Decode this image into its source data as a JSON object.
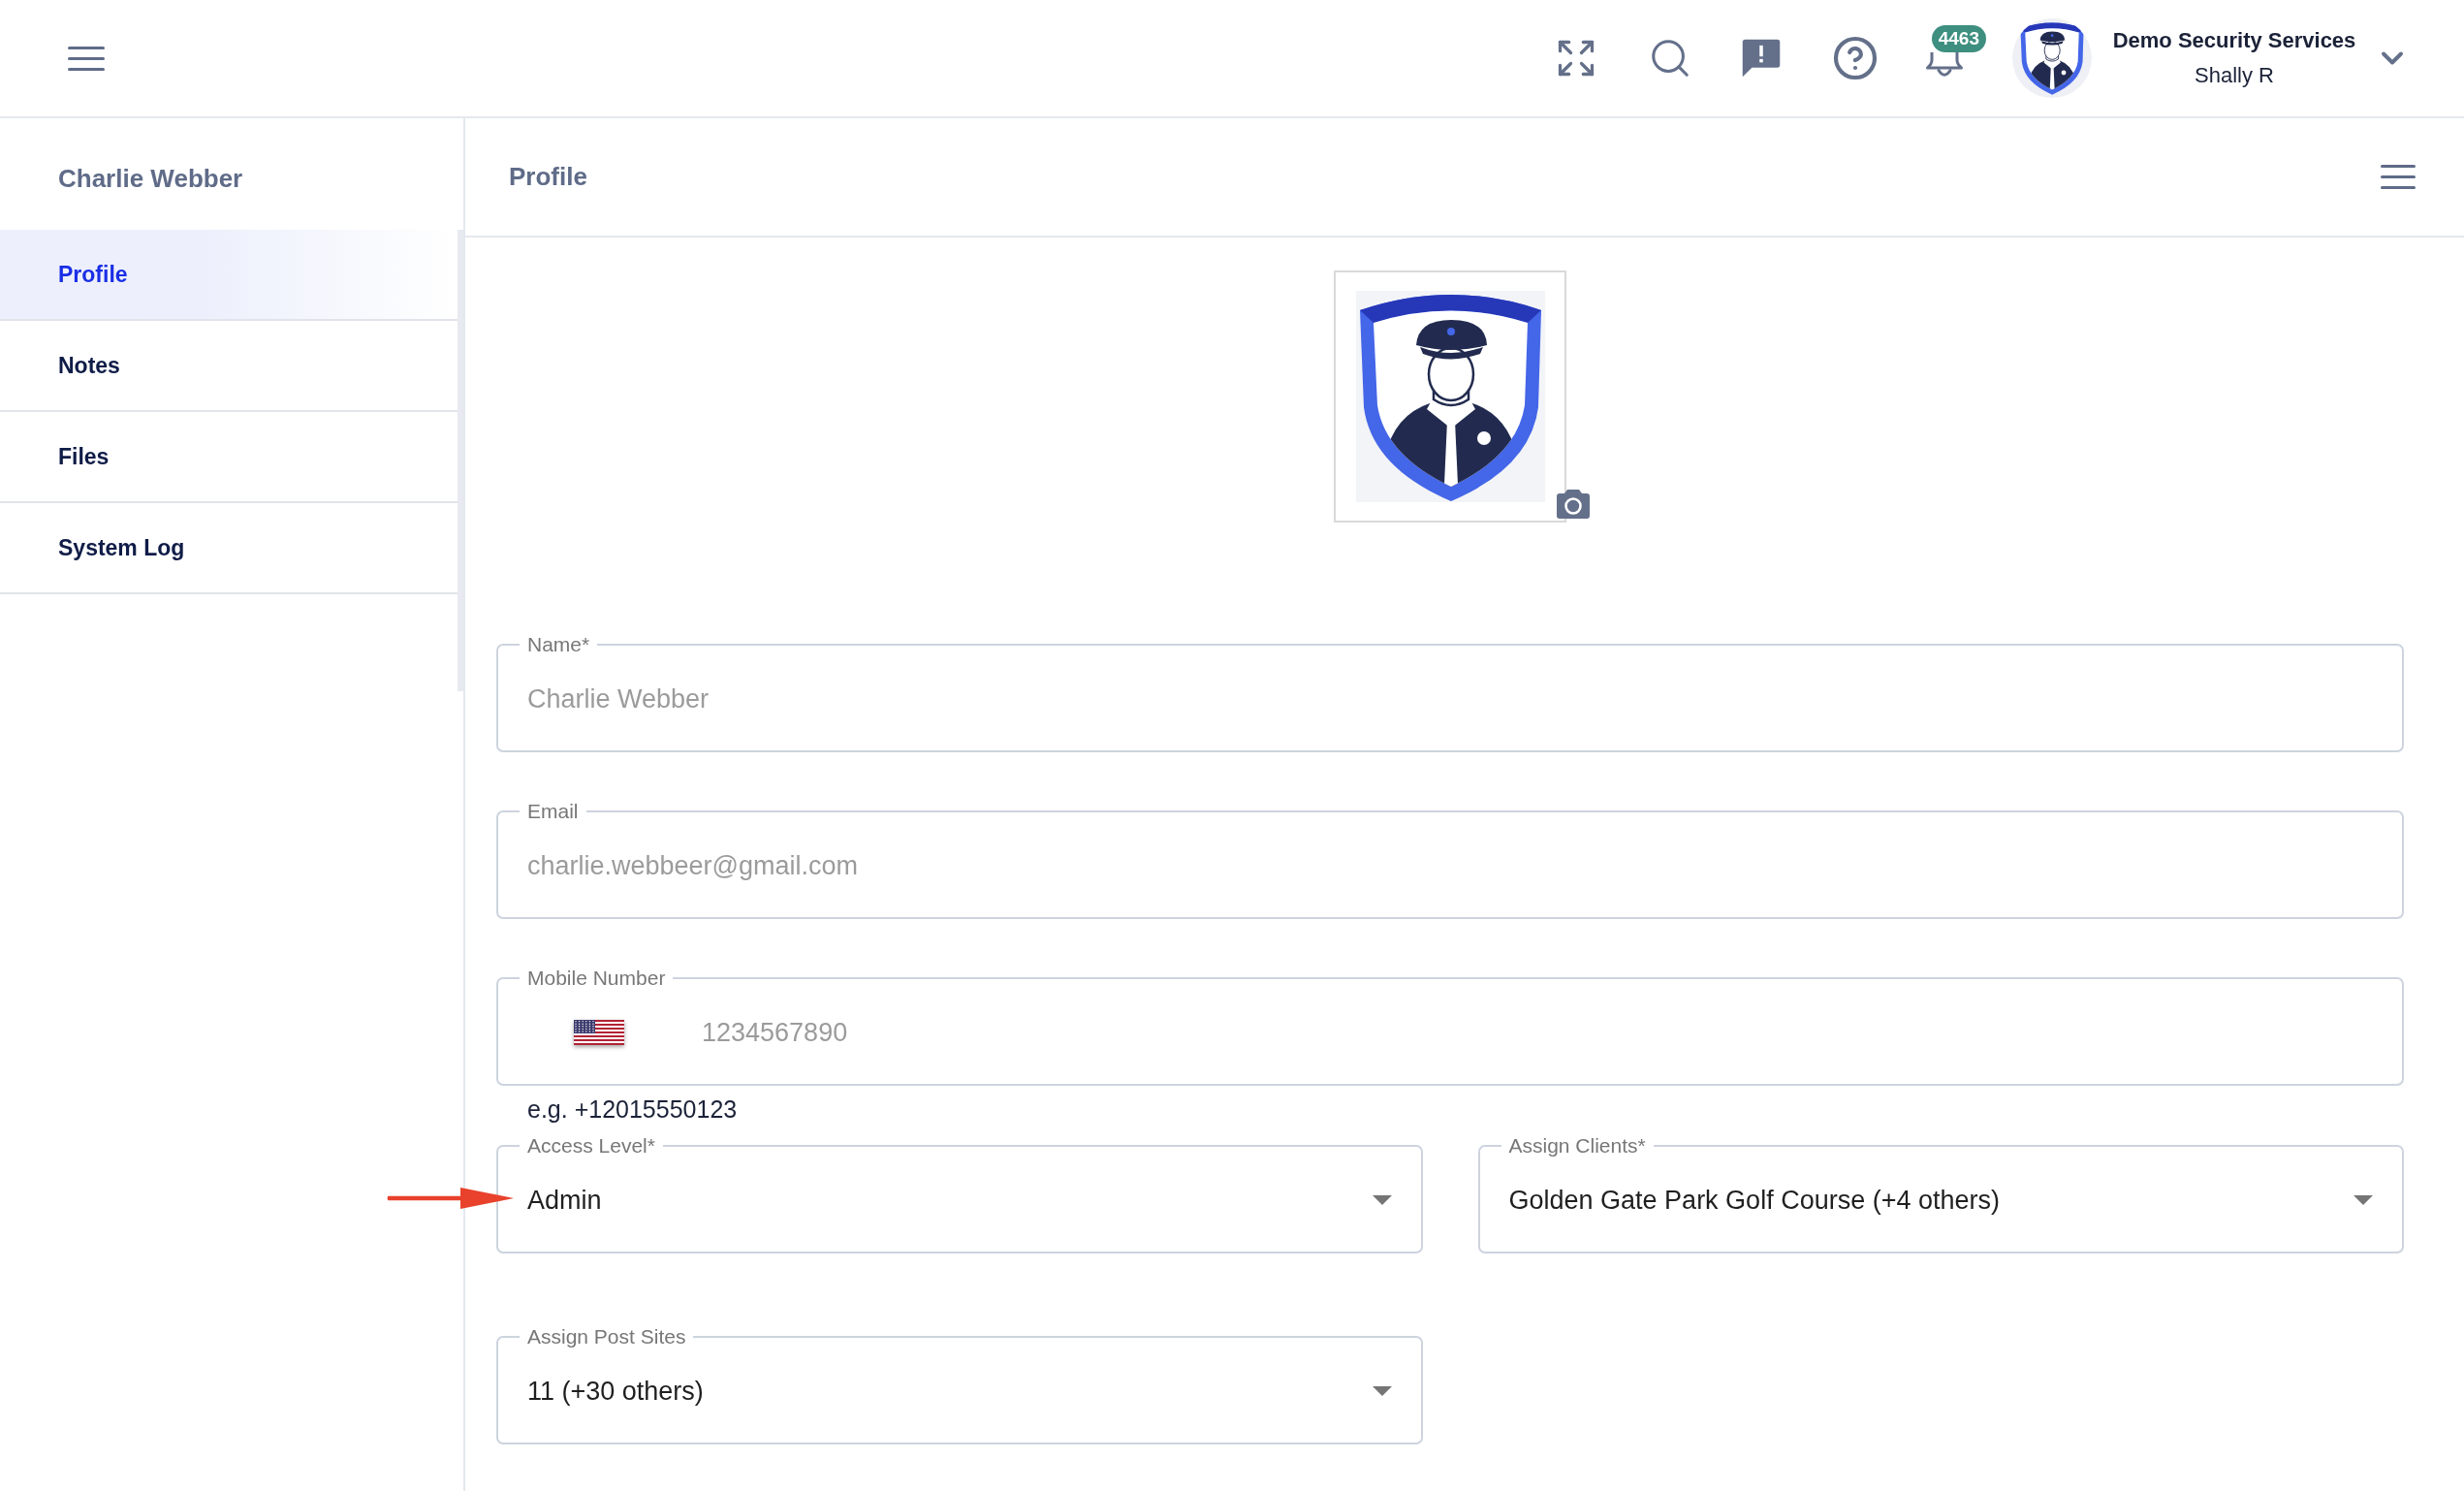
{
  "topbar": {
    "notification_count": "4463",
    "account": {
      "company": "Demo Security Services",
      "user": "Shally R"
    }
  },
  "sidebar": {
    "title": "Charlie Webber",
    "items": [
      {
        "label": "Profile",
        "selected": true
      },
      {
        "label": "Notes",
        "selected": false
      },
      {
        "label": "Files",
        "selected": false
      },
      {
        "label": "System Log",
        "selected": false
      }
    ]
  },
  "main": {
    "title": "Profile"
  },
  "form": {
    "name": {
      "label": "Name*",
      "value": "Charlie Webber",
      "disabled": true
    },
    "email": {
      "label": "Email",
      "value": "charlie.webbeer@gmail.com",
      "disabled": true
    },
    "mobile": {
      "label": "Mobile Number",
      "value": "1234567890",
      "helper": "e.g. +12015550123",
      "disabled": true
    },
    "access_level": {
      "label": "Access Level*",
      "value": "Admin",
      "disabled": false
    },
    "assign_clients": {
      "label": "Assign Clients*",
      "value": "Golden Gate Park Golf Course (+4 others)",
      "disabled": false
    },
    "assign_post_sites": {
      "label": "Assign Post Sites",
      "value": "11 (+30 others)",
      "disabled": false
    }
  }
}
